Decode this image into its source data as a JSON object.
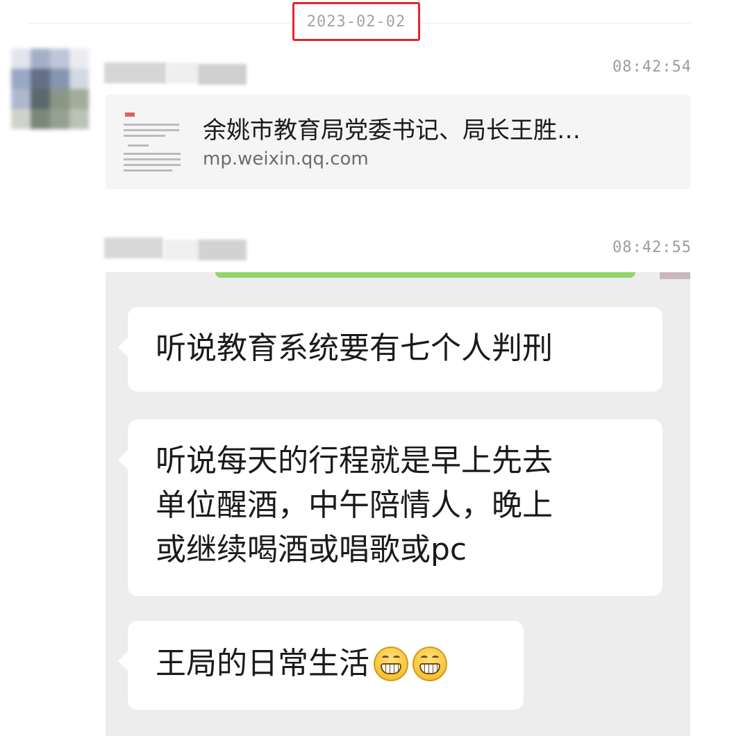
{
  "date_divider": {
    "label": "2023-02-02",
    "highlight_color": "#e3262b"
  },
  "messages": [
    {
      "time": "08:42:54",
      "link_card": {
        "title": "余姚市教育局党委书记、局长王胜…",
        "source": "mp.weixin.qq.com"
      }
    },
    {
      "time": "08:42:55",
      "embedded_chat": {
        "bubbles": [
          {
            "text": "听说教育系统要有七个人判刑"
          },
          {
            "lines": [
              "听说每天的行程就是早上先去",
              "单位醒酒，中午陪情人，晚上",
              "或继续喝酒或唱歌或pc"
            ]
          },
          {
            "text": "王局的日常生活",
            "emoji": [
              "grin-emoji",
              "grin-emoji"
            ]
          }
        ],
        "background_color": "#ededed",
        "bubble_color": "#ffffff"
      }
    }
  ]
}
